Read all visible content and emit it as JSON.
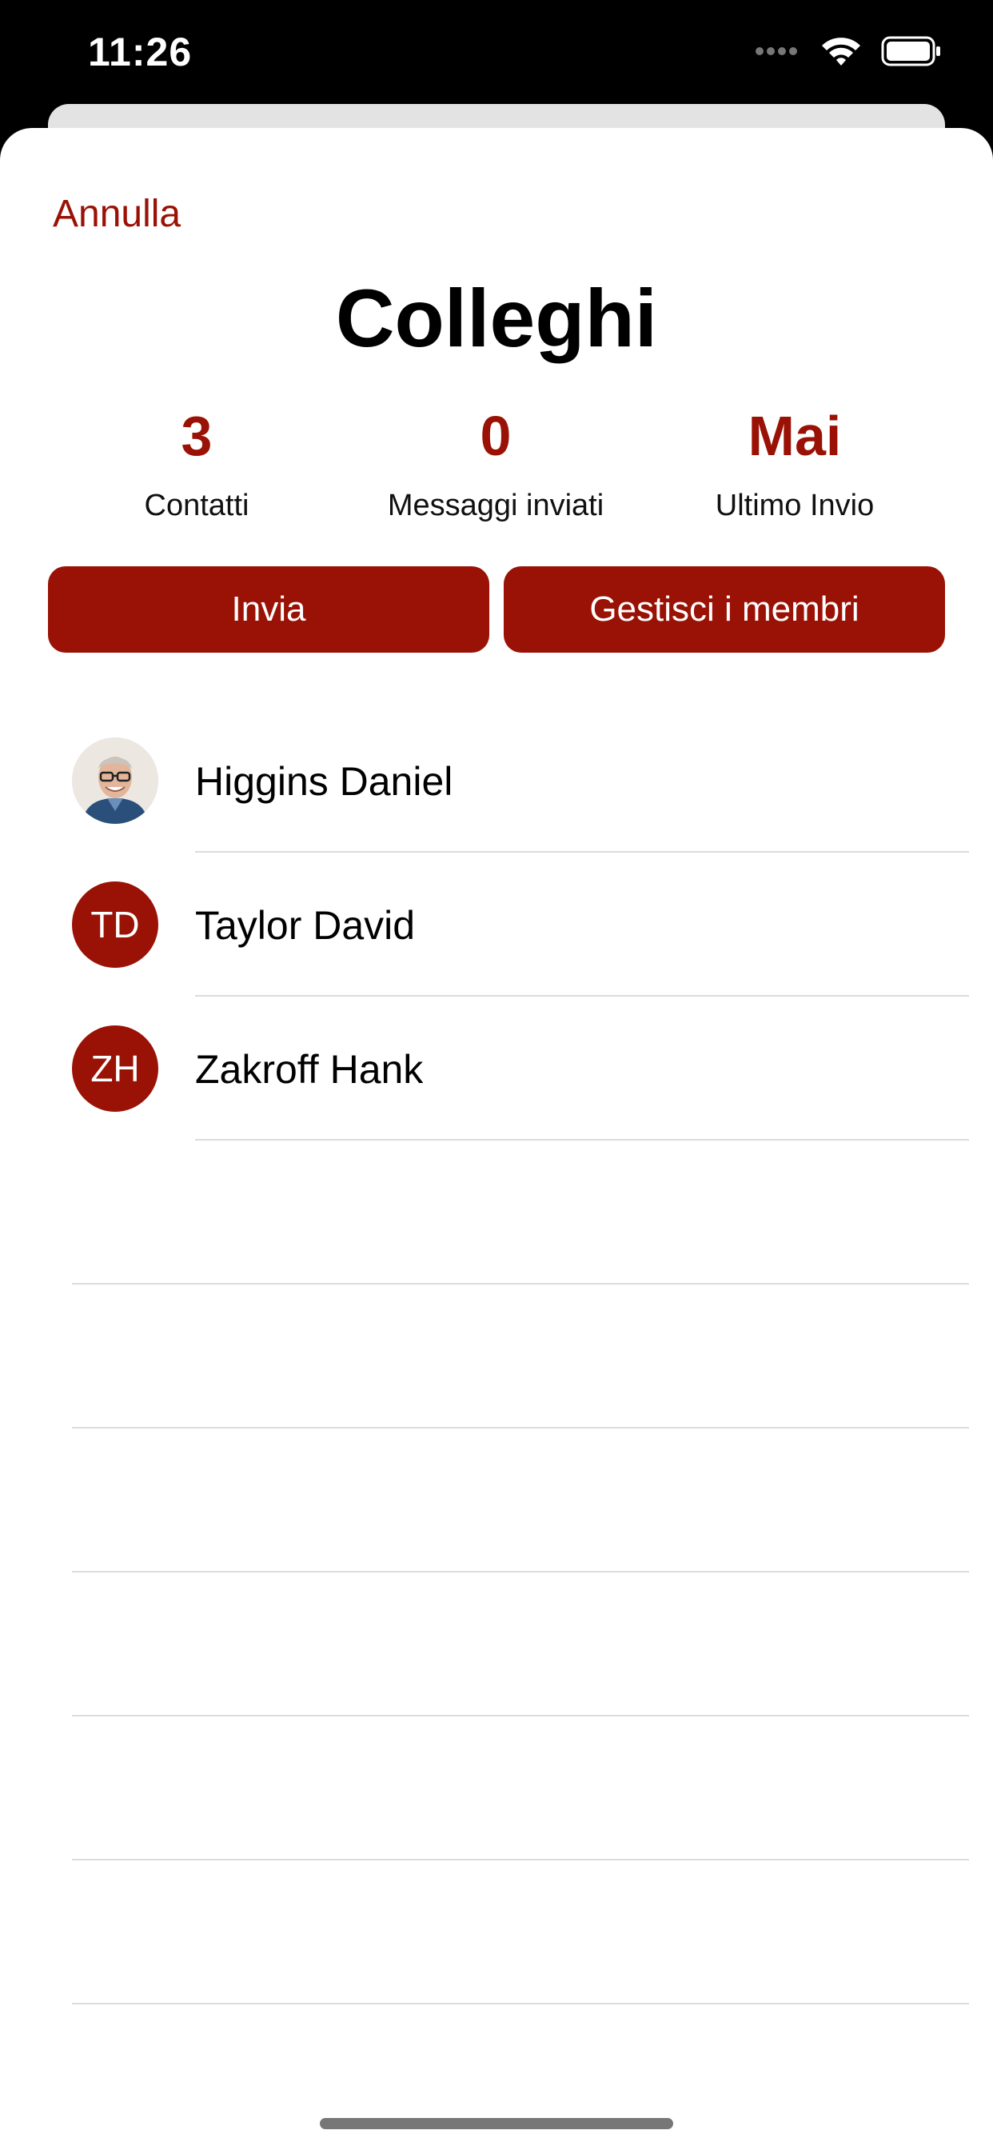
{
  "status_bar": {
    "time": "11:26",
    "icons": [
      "signal-icon",
      "wifi-icon",
      "battery-icon"
    ]
  },
  "sheet": {
    "cancel_label": "Annulla",
    "title": "Colleghi",
    "accent_color": "#9a1205"
  },
  "stats": [
    {
      "value": "3",
      "label": "Contatti"
    },
    {
      "value": "0",
      "label": "Messaggi inviati"
    },
    {
      "value": "Mai",
      "label": "Ultimo Invio"
    }
  ],
  "actions": {
    "send_label": "Invia",
    "manage_label": "Gestisci i membri"
  },
  "members": [
    {
      "name": "Higgins Daniel",
      "initials": "",
      "avatar": "photo"
    },
    {
      "name": "Taylor David",
      "initials": "TD",
      "avatar": "initials"
    },
    {
      "name": "Zakroff Hank",
      "initials": "ZH",
      "avatar": "initials"
    }
  ]
}
